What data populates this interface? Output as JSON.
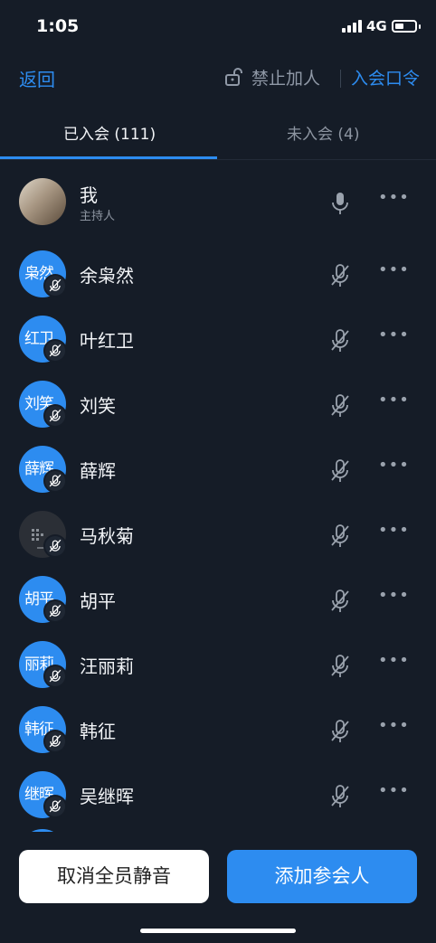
{
  "status_bar": {
    "time": "1:05",
    "network": "4G"
  },
  "nav": {
    "back": "返回",
    "lock_label": "禁止加人",
    "passcode": "入会口令"
  },
  "tabs": [
    {
      "label": "已入会 (111)"
    },
    {
      "label": "未入会 (4)"
    }
  ],
  "participants": [
    {
      "name": "我",
      "role": "主持人",
      "avatar_text": "",
      "avatar_type": "photo",
      "muted": false
    },
    {
      "name": "余枭然",
      "avatar_text": "枭然",
      "avatar_type": "initials",
      "muted": true
    },
    {
      "name": "叶红卫",
      "avatar_text": "红卫",
      "avatar_type": "initials",
      "muted": true
    },
    {
      "name": "刘笑",
      "avatar_text": "刘笑",
      "avatar_type": "initials",
      "muted": true
    },
    {
      "name": "薛辉",
      "avatar_text": "薛辉",
      "avatar_type": "initials",
      "muted": true
    },
    {
      "name": "马秋菊",
      "avatar_text": "",
      "avatar_type": "dark",
      "muted": true
    },
    {
      "name": "胡平",
      "avatar_text": "胡平",
      "avatar_type": "initials",
      "muted": true
    },
    {
      "name": "汪丽莉",
      "avatar_text": "丽莉",
      "avatar_type": "initials",
      "muted": true
    },
    {
      "name": "韩征",
      "avatar_text": "韩征",
      "avatar_type": "initials",
      "muted": true
    },
    {
      "name": "吴继晖",
      "avatar_text": "继晖",
      "avatar_type": "initials",
      "muted": true
    }
  ],
  "more_label": "•••",
  "buttons": {
    "unmute_all": "取消全员静音",
    "add_participant": "添加参会人"
  },
  "colors": {
    "accent": "#2d8cf0",
    "background": "#151c27"
  }
}
